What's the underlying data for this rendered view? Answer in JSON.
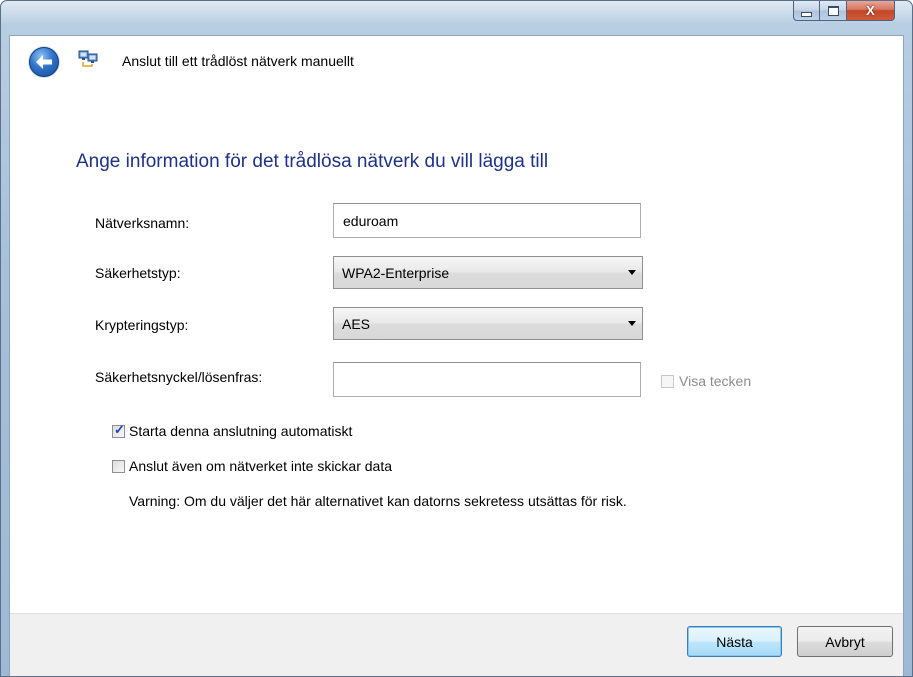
{
  "window": {
    "buttons": {
      "minimize_icon": "minimize-icon",
      "maximize_icon": "maximize-icon",
      "close_label": "X"
    }
  },
  "wizard": {
    "back_icon": "back-arrow-icon",
    "app_icon": "network-icon",
    "title": "Anslut till ett trådlöst nätverk manuellt"
  },
  "form": {
    "heading": "Ange information för det trådlösa nätverk du vill lägga till",
    "network_name": {
      "label": "Nätverksnamn:",
      "value": "eduroam"
    },
    "security_type": {
      "label": "Säkerhetstyp:",
      "value": "WPA2-Enterprise"
    },
    "encryption_type": {
      "label": "Krypteringstyp:",
      "value": "AES"
    },
    "security_key": {
      "label": "Säkerhetsnyckel/lösenfras:",
      "value": ""
    },
    "show_characters": {
      "label": "Visa tecken",
      "checked": false,
      "enabled": false
    },
    "auto_start": {
      "label": "Starta denna anslutning automatiskt",
      "checked": true
    },
    "connect_non_broadcast": {
      "label": "Anslut även om nätverket inte skickar data",
      "checked": false
    },
    "warning": "Varning: Om du väljer det här alternativet kan datorns sekretess utsättas för risk."
  },
  "footer": {
    "next_label": "Nästa",
    "cancel_label": "Avbryt"
  },
  "colors": {
    "heading": "#1e3287",
    "accent_blue": "#2f73c9",
    "close_red": "#c24628"
  }
}
